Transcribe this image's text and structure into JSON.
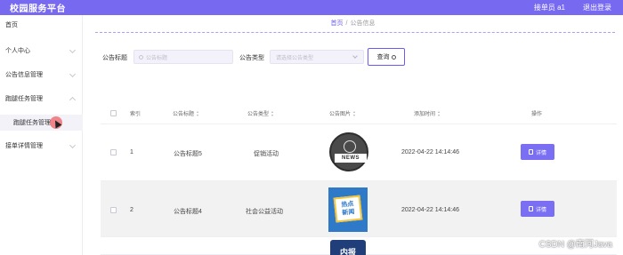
{
  "header": {
    "title": "校园服务平台",
    "user_label": "接单员 a1",
    "logout_label": "退出登录",
    "accent_color": "#7769f0"
  },
  "sidebar": {
    "items": [
      {
        "label": "首页"
      },
      {
        "label": "个人中心"
      },
      {
        "label": "公告信息管理"
      },
      {
        "label": "跑腿任务管理"
      },
      {
        "label": "跑腿任务管理"
      },
      {
        "label": "接单详情管理"
      }
    ]
  },
  "breadcrumb": {
    "home": "首页",
    "separator": "/",
    "current": "公告信息"
  },
  "search": {
    "title_label": "公告标题",
    "title_placeholder": "公告标题",
    "type_label": "公告类型",
    "type_placeholder": "请选择公告类型",
    "button_label": "查询"
  },
  "table": {
    "headers": {
      "index": "索引",
      "title": "公告标题",
      "type": "公告类型",
      "image": "公告图片",
      "time": "添加时间",
      "action": "操作"
    },
    "rows": [
      {
        "index": "1",
        "title": "公告标题5",
        "type": "促销活动",
        "image": "news-image",
        "image_text": "NEWS",
        "time": "2022-04-22 14:14:46",
        "action": "详情"
      },
      {
        "index": "2",
        "title": "公告标题4",
        "type": "社会公益活动",
        "image": "hot-news-image",
        "image_text_1": "热点",
        "image_text_2": "新闻",
        "time": "2022-04-22 14:14:46",
        "action": "详情"
      },
      {
        "index": "",
        "title": "",
        "type": "",
        "image": "partial-image",
        "image_text": "内报",
        "time": "",
        "action": ""
      }
    ]
  },
  "watermark": "CSDN @南河Java"
}
